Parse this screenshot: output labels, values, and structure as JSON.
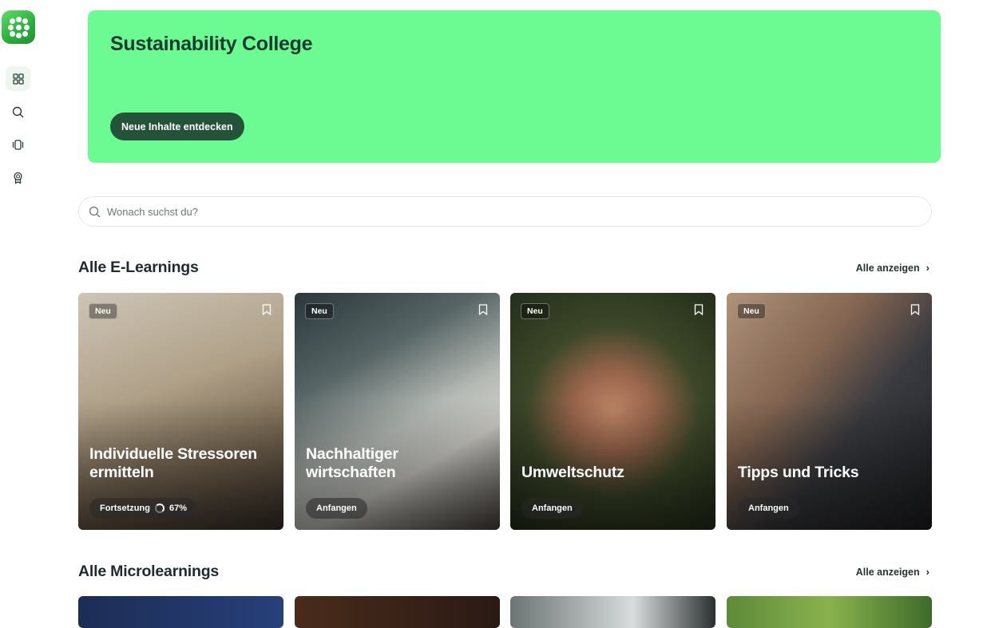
{
  "app": {
    "accent": "#6cfb93",
    "button_color": "#24533a"
  },
  "sidebar": {
    "items": [
      {
        "name": "dashboard",
        "icon": "grid-icon",
        "active": true
      },
      {
        "name": "search",
        "icon": "search-icon",
        "active": false
      },
      {
        "name": "cards",
        "icon": "cards-icon",
        "active": false
      },
      {
        "name": "achievements",
        "icon": "award-icon",
        "active": false
      }
    ]
  },
  "hero": {
    "title": "Sustainability College",
    "button_label": "Neue Inhalte entdecken"
  },
  "search": {
    "placeholder": "Wonach suchst du?"
  },
  "elearnings": {
    "title": "Alle E-Learnings",
    "see_all": "Alle anzeigen",
    "cards": [
      {
        "badge": "Neu",
        "title": "Individuelle Stressoren ermitteln",
        "action": "Fortsetzung",
        "progress": "67%"
      },
      {
        "badge": "Neu",
        "title": "Nachhaltiger wirtschaften",
        "action": "Anfangen"
      },
      {
        "badge": "Neu",
        "title": "Umweltschutz",
        "action": "Anfangen"
      },
      {
        "badge": "Neu",
        "title": "Tipps und Tricks",
        "action": "Anfangen"
      }
    ]
  },
  "microlearnings": {
    "title": "Alle Microlearnings",
    "see_all": "Alle anzeigen"
  }
}
